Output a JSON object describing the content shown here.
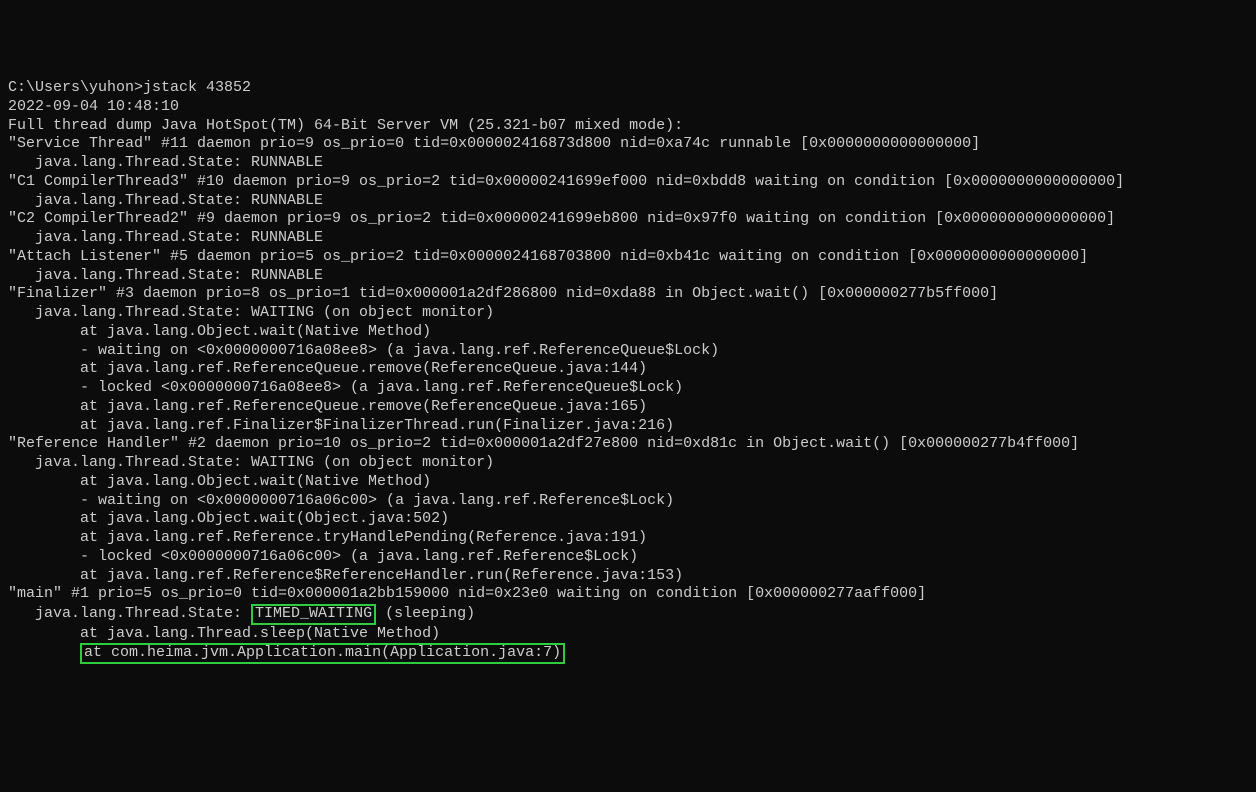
{
  "prompt": "C:\\Users\\yuhon>jstack 43852",
  "timestamp": "2022-09-04 10:48:10",
  "header": "Full thread dump Java HotSpot(TM) 64-Bit Server VM (25.321-b07 mixed mode):",
  "threads": [
    {
      "title": "\"Service Thread\" #11 daemon prio=9 os_prio=0 tid=0x000002416873d800 nid=0xa74c runnable [0x0000000000000000]",
      "state": "   java.lang.Thread.State: RUNNABLE"
    },
    {
      "title": "\"C1 CompilerThread3\" #10 daemon prio=9 os_prio=2 tid=0x00000241699ef000 nid=0xbdd8 waiting on condition [0x0000000000000000]",
      "state": "   java.lang.Thread.State: RUNNABLE"
    },
    {
      "title": "\"C2 CompilerThread2\" #9 daemon prio=9 os_prio=2 tid=0x00000241699eb800 nid=0x97f0 waiting on condition [0x0000000000000000]",
      "state": "   java.lang.Thread.State: RUNNABLE"
    },
    {
      "title": "\"Attach Listener\" #5 daemon prio=5 os_prio=2 tid=0x0000024168703800 nid=0xb41c waiting on condition [0x0000000000000000]",
      "state": "   java.lang.Thread.State: RUNNABLE"
    },
    {
      "title": "\"Finalizer\" #3 daemon prio=8 os_prio=1 tid=0x000001a2df286800 nid=0xda88 in Object.wait() [0x000000277b5ff000]",
      "state": "   java.lang.Thread.State: WAITING (on object monitor)",
      "stack": [
        "        at java.lang.Object.wait(Native Method)",
        "        - waiting on <0x0000000716a08ee8> (a java.lang.ref.ReferenceQueue$Lock)",
        "        at java.lang.ref.ReferenceQueue.remove(ReferenceQueue.java:144)",
        "        - locked <0x0000000716a08ee8> (a java.lang.ref.ReferenceQueue$Lock)",
        "        at java.lang.ref.ReferenceQueue.remove(ReferenceQueue.java:165)",
        "        at java.lang.ref.Finalizer$FinalizerThread.run(Finalizer.java:216)"
      ]
    },
    {
      "title": "\"Reference Handler\" #2 daemon prio=10 os_prio=2 tid=0x000001a2df27e800 nid=0xd81c in Object.wait() [0x000000277b4ff000]",
      "state": "   java.lang.Thread.State: WAITING (on object monitor)",
      "stack": [
        "        at java.lang.Object.wait(Native Method)",
        "        - waiting on <0x0000000716a06c00> (a java.lang.ref.Reference$Lock)",
        "        at java.lang.Object.wait(Object.java:502)",
        "        at java.lang.ref.Reference.tryHandlePending(Reference.java:191)",
        "        - locked <0x0000000716a06c00> (a java.lang.ref.Reference$Lock)",
        "        at java.lang.ref.Reference$ReferenceHandler.run(Reference.java:153)"
      ]
    }
  ],
  "main_thread": {
    "title": "\"main\" #1 prio=5 os_prio=0 tid=0x000001a2bb159000 nid=0x23e0 waiting on condition [0x000000277aaff000]",
    "state_prefix": "   java.lang.Thread.State: ",
    "state_highlight": "TIMED_WAITING",
    "state_suffix": " (sleeping)",
    "stack_line1": "        at java.lang.Thread.sleep(Native Method)",
    "stack_line2_prefix": "        ",
    "stack_line2_highlight": "at com.heima.jvm.Application.main(Application.java:7)"
  }
}
